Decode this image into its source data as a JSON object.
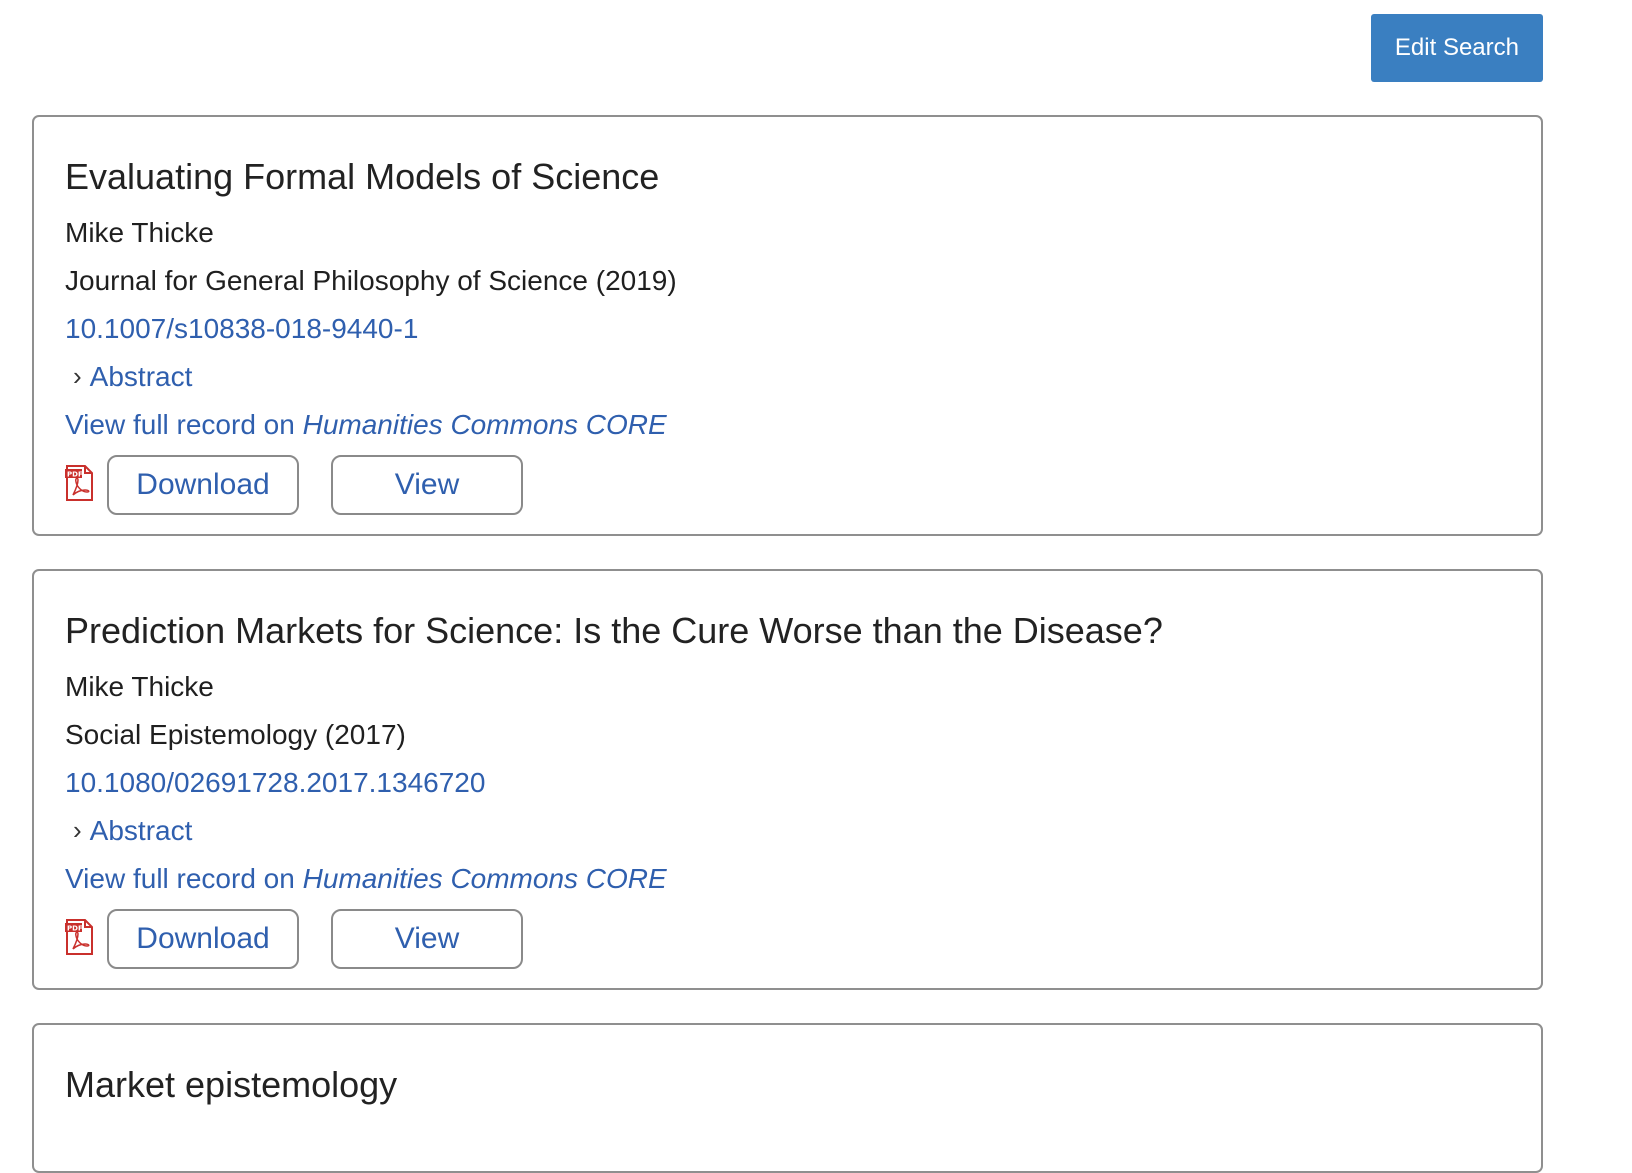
{
  "toolbar": {
    "edit_search_label": "Edit Search"
  },
  "results": [
    {
      "title": "Evaluating Formal Models of Science",
      "author": "Mike Thicke",
      "journal": "Journal for General Philosophy of Science (2019)",
      "doi": "10.1007/s10838-018-9440-1",
      "abstract_label": "Abstract",
      "full_record_prefix": "View full record on ",
      "full_record_source": "Humanities Commons CORE",
      "file_icon": "pdf-icon",
      "download_label": "Download",
      "view_label": "View"
    },
    {
      "title": "Prediction Markets for Science: Is the Cure Worse than the Disease?",
      "author": "Mike Thicke",
      "journal": "Social Epistemology (2017)",
      "doi": "10.1080/02691728.2017.1346720",
      "abstract_label": "Abstract",
      "full_record_prefix": "View full record on ",
      "full_record_source": "Humanities Commons CORE",
      "file_icon": "pdf-icon",
      "download_label": "Download",
      "view_label": "View"
    },
    {
      "title": "Market epistemology"
    }
  ],
  "colors": {
    "primary_button": "#3a7fc1",
    "link": "#2f5fae",
    "pdf_red": "#c9302c"
  }
}
